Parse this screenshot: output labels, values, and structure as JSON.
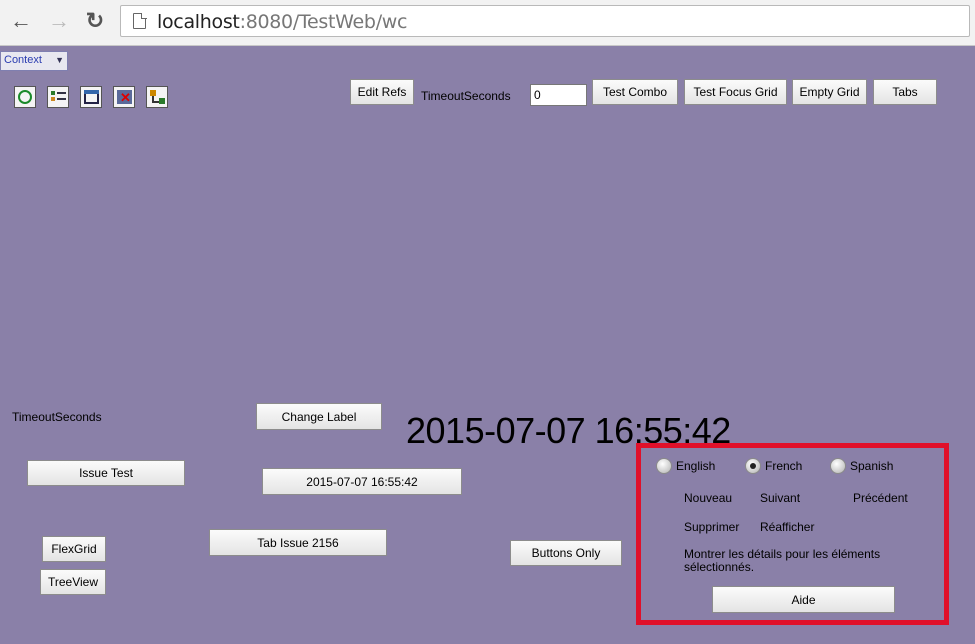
{
  "browser": {
    "url_host": "localhost",
    "url_rest": ":8080/TestWeb/wc"
  },
  "context": {
    "label": "Context"
  },
  "toolbar": {
    "edit_refs": "Edit Refs",
    "timeout_label": "TimeoutSeconds",
    "timeout_value": "0",
    "test_combo": "Test Combo",
    "test_focus_grid": "Test Focus Grid",
    "empty_grid": "Empty Grid",
    "tabs": "Tabs"
  },
  "left": {
    "timeout_label": "TimeoutSeconds",
    "issue_test": "Issue Test",
    "flexgrid": "FlexGrid",
    "treeview": "TreeView"
  },
  "center": {
    "change_label": "Change Label",
    "date_button": "2015-07-07 16:55:42",
    "tab_issue": "Tab Issue 2156",
    "buttons_only": "Buttons Only",
    "big_date": "2015-07-07 16:55:42"
  },
  "lang_panel": {
    "english": "English",
    "french": "French",
    "spanish": "Spanish",
    "selected": "French",
    "nouveau": "Nouveau",
    "suivant": "Suivant",
    "precedent": "Précédent",
    "supprimer": "Supprimer",
    "reafficher": "Réafficher",
    "description": "Montrer les détails pour les éléments sélectionnés.",
    "aide": "Aide"
  },
  "colors": {
    "page_bg": "#8a80a8",
    "highlight": "#e0102a"
  }
}
